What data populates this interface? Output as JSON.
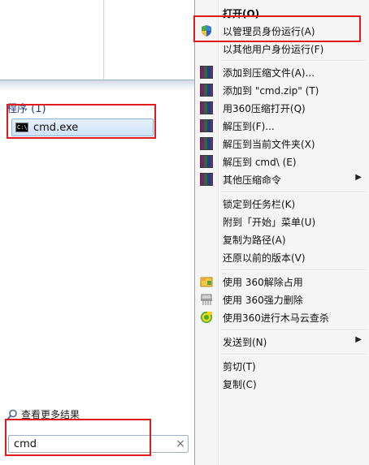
{
  "start_menu": {
    "section_header": "程序 (1)",
    "program_item": {
      "label": "cmd.exe",
      "icon": "cmd-icon"
    },
    "see_more": "查看更多结果",
    "search": {
      "value": "cmd",
      "clear_icon": "×"
    }
  },
  "context_menu": {
    "items": [
      {
        "label": "打开(O)",
        "bold": true,
        "icon": ""
      },
      {
        "label": "以管理员身份运行(A)",
        "icon": "uac-shield-icon"
      },
      {
        "label": "以其他用户身份运行(F)",
        "icon": ""
      },
      {
        "label": "添加到压缩文件(A)...",
        "icon": "winrar-icon"
      },
      {
        "label": "添加到 \"cmd.zip\" (T)",
        "icon": "winrar-icon"
      },
      {
        "label": "用360压缩打开(Q)",
        "icon": "winrar-icon"
      },
      {
        "label": "解压到(F)...",
        "icon": "winrar-icon"
      },
      {
        "label": "解压到当前文件夹(X)",
        "icon": "winrar-icon"
      },
      {
        "label": "解压到 cmd\\ (E)",
        "icon": "winrar-icon"
      },
      {
        "label": "其他压缩命令",
        "icon": "winrar-icon",
        "submenu": true
      },
      {
        "label": "锁定到任务栏(K)",
        "icon": ""
      },
      {
        "label": "附到「开始」菜单(U)",
        "icon": ""
      },
      {
        "label": "复制为路径(A)",
        "icon": ""
      },
      {
        "label": "还原以前的版本(V)",
        "icon": ""
      },
      {
        "label": "使用 360解除占用",
        "icon": "unlock-360-icon"
      },
      {
        "label": "使用 360强力删除",
        "icon": "shredder-360-icon"
      },
      {
        "label": "使用360进行木马云查杀",
        "icon": "antivirus-360-icon"
      },
      {
        "label": "发送到(N)",
        "icon": "",
        "submenu": true
      },
      {
        "label": "剪切(T)",
        "icon": ""
      },
      {
        "label": "复制(C)",
        "icon": ""
      }
    ],
    "submenu_arrow": "▶"
  },
  "colors": {
    "annotation_red": "#e01b1b",
    "menu_bg": "#f5f5f5",
    "selection_blue": "#cfe2f8"
  }
}
